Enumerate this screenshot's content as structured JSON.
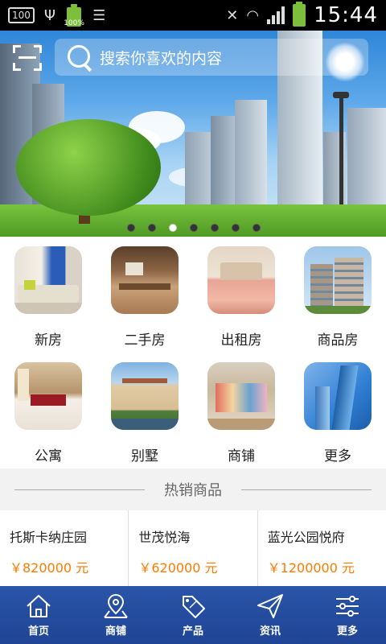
{
  "status_bar": {
    "notify_badge": "100",
    "battery_small_text": "100%",
    "time": "15:44"
  },
  "search": {
    "placeholder": "搜索你喜欢的内容"
  },
  "banner": {
    "slide_count": 7,
    "active_slide": 3
  },
  "categories": [
    {
      "label": "新房",
      "icon": "living-room-photo"
    },
    {
      "label": "二手房",
      "icon": "kitchen-photo"
    },
    {
      "label": "出租房",
      "icon": "bedroom-photo"
    },
    {
      "label": "商品房",
      "icon": "apartment-building-photo"
    },
    {
      "label": "公寓",
      "icon": "hotel-room-photo"
    },
    {
      "label": "别墅",
      "icon": "villa-photo"
    },
    {
      "label": "商铺",
      "icon": "shop-photo"
    },
    {
      "label": "更多",
      "icon": "skyscraper-photo"
    }
  ],
  "hot": {
    "title": "热销商品",
    "items": [
      {
        "name": "托斯卡纳庄园",
        "price": "￥820000 元"
      },
      {
        "name": "世茂悦海",
        "price": "￥620000 元"
      },
      {
        "name": "蓝光公园悦府",
        "price": "￥1200000 元"
      }
    ]
  },
  "tabs": [
    {
      "label": "首页",
      "icon": "home-icon"
    },
    {
      "label": "商铺",
      "icon": "map-pin-icon"
    },
    {
      "label": "产品",
      "icon": "sale-tag-icon"
    },
    {
      "label": "资讯",
      "icon": "paper-plane-icon"
    },
    {
      "label": "更多",
      "icon": "sliders-icon"
    }
  ],
  "colors": {
    "accent": "#ff7a00",
    "tabbar": "#1f4495"
  }
}
